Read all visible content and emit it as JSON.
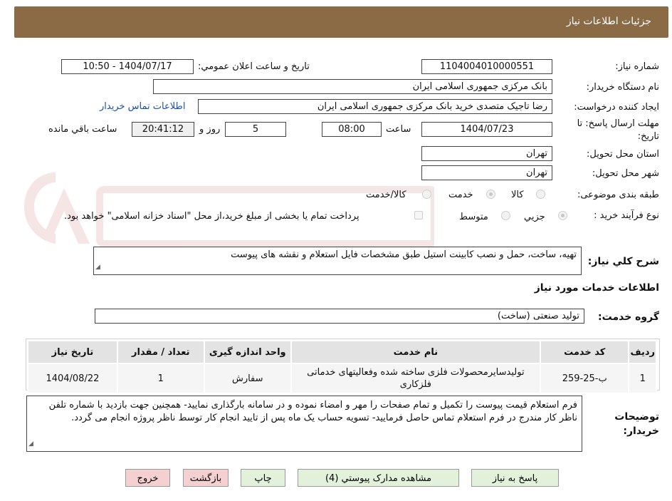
{
  "header": {
    "title": "جزئیات اطلاعات نیاز"
  },
  "form": {
    "need_number_label": "شماره نیاز:",
    "need_number": "1104004010000551",
    "announce_label": "تاریخ و ساعت اعلان عمومي:",
    "announce_value": "1404/07/17 - 10:50",
    "buyer_org_label": "نام دستگاه خريدار:",
    "buyer_org": "بانک مرکزی جمهوری اسلامی ایران",
    "requester_label": "ايجاد کننده درخواست:",
    "requester": "رضا تاجیک متصدی خرید بانک مرکزی جمهوری اسلامی ایران",
    "contact_link": "اطلاعات تماس خريدار",
    "deadline_label_1": "مهلت ارسال پاسخ: تا",
    "deadline_label_2": "تاريخ:",
    "deadline_date": "1404/07/23",
    "time_label": "ساعت",
    "deadline_time": "08:00",
    "days_value": "5",
    "days_label": "روز و",
    "remaining_time": "20:41:12",
    "remaining_label": "ساعت باقي مانده",
    "province_label": "استان محل تحویل:",
    "province": "تهران",
    "city_label": "شهر محل تحویل:",
    "city": "تهران",
    "category_label": "طبقه بندی موضوعی:",
    "category_options": [
      "کالا",
      "خدمت",
      "کالا/خدمت"
    ],
    "category_selected": "خدمت",
    "process_label": "نوع فرآيند خريد :",
    "process_options": [
      "جزيي",
      "متوسط"
    ],
    "process_selected": "جزيي",
    "payment_note": "پرداخت تمام يا بخشی از مبلغ خريد،از محل \"اسناد خزانه اسلامی\" خواهد بود."
  },
  "description": {
    "label": "شرح کلي نياز:",
    "text": "تهیه، ساخت، حمل و نصب کابینت استیل طبق مشخصات فایل استعلام و نقشه های پیوست"
  },
  "services": {
    "section_title": "اطلاعات خدمات مورد نياز",
    "group_label": "گروه خدمت:",
    "group_value": "تولید صنعتی (ساخت)",
    "columns": [
      "رديف",
      "کد خدمت",
      "نام خدمت",
      "واحد اندازه گيری",
      "تعداد / مقدار",
      "تاريخ نياز"
    ],
    "rows": [
      {
        "row": "1",
        "code": "ب-25-259",
        "name": "تولیدسایرمحصولات فلزی ساخته شده وفعالیتهای خدماتی فلزکاری",
        "unit": "سفارش",
        "qty": "1",
        "date": "1404/08/22"
      }
    ]
  },
  "buyer_notes": {
    "label_1": "توضيحات",
    "label_2": "خريدار:",
    "text": "فرم استعلام قیمت پیوست را تکمیل و تمام صفحات را مهر و امضاء نموده و در سامانه بارگذاری نمایید- همچنین جهت بازدید با شماره تلفن ناظر کار مندرج در فرم استعلام تماس حاصل فرمایید- تسویه حساب یک ماه پس از تایید انجام کار توسط ناظر پروژه انجام می گردد."
  },
  "buttons": {
    "reply": "پاسخ به نياز",
    "attachments": "مشاهده مدارک پيوستي (4)",
    "print": "چاپ",
    "back": "بازگشت",
    "exit": "خروج"
  },
  "colors": {
    "header_bg": "#8b6b45",
    "button_green": "#e2f1d9",
    "button_red": "#f5d0d0",
    "link": "#1a4fb0"
  }
}
